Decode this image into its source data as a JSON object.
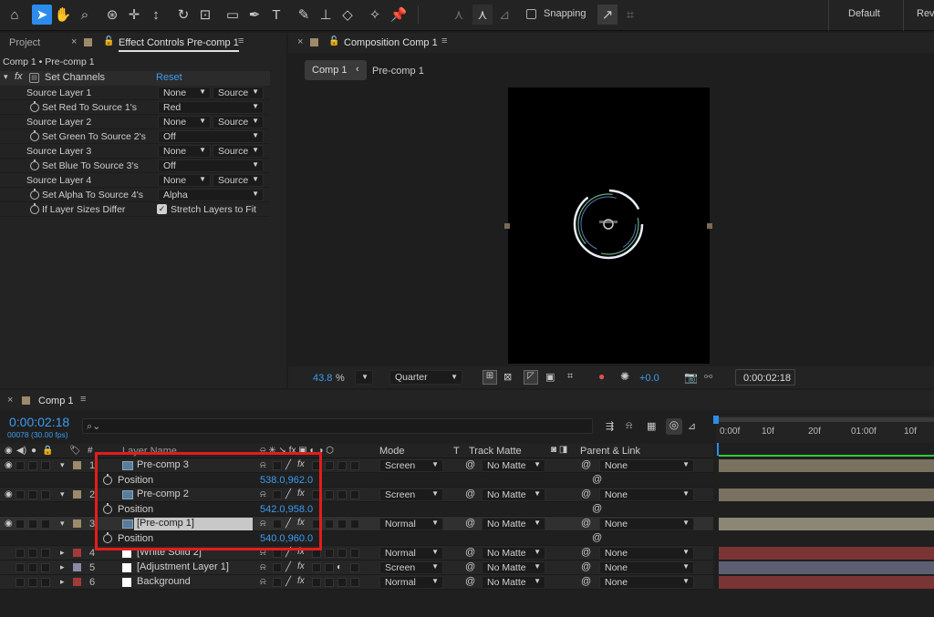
{
  "toolbar": {
    "snapping_label": "Snapping",
    "workspace_default": "Default",
    "workspace_next": "Revi",
    "accent": "#2d8ceb"
  },
  "left_tabs": {
    "project": "Project",
    "effect_controls": "Effect Controls Pre-comp 1"
  },
  "effect": {
    "breadcrumb": "Comp 1 • Pre-comp 1",
    "fx_label": "fx",
    "name": "Set Channels",
    "reset": "Reset",
    "props": [
      {
        "label": "Source Layer 1",
        "stopwatch": false,
        "v1": "None",
        "v2": "Source"
      },
      {
        "label": "Set Red To Source 1's",
        "stopwatch": true,
        "v1": "Red"
      },
      {
        "label": "Source Layer 2",
        "stopwatch": false,
        "v1": "None",
        "v2": "Source"
      },
      {
        "label": "Set Green To Source 2's",
        "stopwatch": true,
        "v1": "Off"
      },
      {
        "label": "Source Layer 3",
        "stopwatch": false,
        "v1": "None",
        "v2": "Source"
      },
      {
        "label": "Set Blue To Source 3's",
        "stopwatch": true,
        "v1": "Off"
      },
      {
        "label": "Source Layer 4",
        "stopwatch": false,
        "v1": "None",
        "v2": "Source"
      },
      {
        "label": "Set Alpha To Source 4's",
        "stopwatch": true,
        "v1": "Alpha"
      },
      {
        "label": "If Layer Sizes Differ",
        "stopwatch": true,
        "checkbox": "Stretch Layers to Fit"
      }
    ]
  },
  "comp_panel": {
    "tab": "Composition Comp 1",
    "crumb_active": "Comp 1",
    "crumb_next": "Pre-comp 1",
    "zoom": "43.8",
    "zoom_unit": "%",
    "resolution": "Quarter",
    "exposure": "+0.0",
    "timecode": "0:00:02:18"
  },
  "timeline": {
    "tab": "Comp 1",
    "timecode": "0:00:02:18",
    "frames": "00078 (30.00 fps)",
    "search_placeholder": "",
    "col_layer_name": "Layer Name",
    "col_mode": "Mode",
    "col_t": "T",
    "col_track_matte": "Track Matte",
    "col_parent": "Parent & Link",
    "ruler": [
      "0:00f",
      "10f",
      "20f",
      "01:00f",
      "10f"
    ],
    "layers": [
      {
        "num": "1",
        "name": "Pre-comp 3",
        "mode": "Screen",
        "matte": "No Matte",
        "parent": "None",
        "color": "#9c8a6a",
        "bar": "#7a7160",
        "pos": "538.0,962.0",
        "expanded": true,
        "type": "comp"
      },
      {
        "num": "2",
        "name": "Pre-comp 2",
        "mode": "Screen",
        "matte": "No Matte",
        "parent": "None",
        "color": "#9c8a6a",
        "bar": "#7a7160",
        "pos": "542.0,958.0",
        "expanded": true,
        "type": "comp"
      },
      {
        "num": "3",
        "name": "[Pre-comp 1]",
        "mode": "Normal",
        "matte": "No Matte",
        "parent": "None",
        "color": "#9c8a6a",
        "bar": "#8c8676",
        "pos": "540.0,960.0",
        "expanded": true,
        "type": "comp",
        "selected": true
      },
      {
        "num": "4",
        "name": "[White Solid 2]",
        "mode": "Normal",
        "matte": "No Matte",
        "parent": "None",
        "color": "#a33a3a",
        "bar": "#7a3434",
        "type": "solid"
      },
      {
        "num": "5",
        "name": "[Adjustment Layer 1]",
        "mode": "Screen",
        "matte": "No Matte",
        "parent": "None",
        "color": "#8a8aa8",
        "bar": "#5e5e72",
        "type": "solid"
      },
      {
        "num": "6",
        "name": "Background",
        "mode": "Normal",
        "matte": "No Matte",
        "parent": "None",
        "color": "#a33a3a",
        "bar": "#7a3434",
        "type": "solid"
      }
    ],
    "position_label": "Position"
  }
}
